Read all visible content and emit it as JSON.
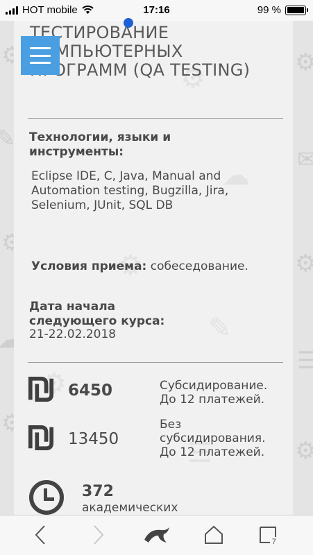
{
  "status_bar": {
    "carrier": "HOT mobile",
    "time": "17:16",
    "battery": "99 %",
    "battery_level": 0.99
  },
  "course": {
    "title": "ТЕСТИРОВАНИЕ КОМПЬЮТЕРНЫХ ПРОГРАММ (QA TESTING)"
  },
  "tech": {
    "label": "Технологии, языки и инструменты:",
    "value": "Eclipse IDE, C, Java, Manual and Automation testing, Bugzilla, Jira, Selenium, JUnit, SQL DB"
  },
  "admission": {
    "label": "Условия приема:",
    "value": "собеседование."
  },
  "start_date": {
    "label": "Дата начала следующего курса:",
    "value": "21-22.02.2018"
  },
  "prices": [
    {
      "amount": "6450",
      "note": "Субсидирование. До 12 платежей."
    },
    {
      "amount": "13450",
      "note": "Без субсидирования. До 12 платежей."
    }
  ],
  "duration": {
    "hours": "372",
    "unit": "академических"
  },
  "toolbar": {
    "tabs_count": "7"
  },
  "colors": {
    "menu_button": "#4a9fe3",
    "card_background": "#f2f2f2",
    "text": "#444444"
  }
}
